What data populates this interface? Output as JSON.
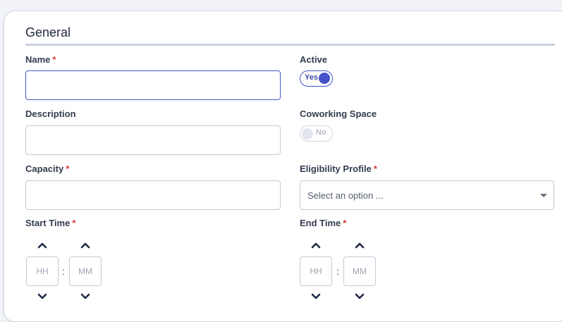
{
  "section": {
    "title": "General"
  },
  "required_marker": "*",
  "fields": {
    "name": {
      "label": "Name",
      "value": ""
    },
    "description": {
      "label": "Description",
      "value": ""
    },
    "capacity": {
      "label": "Capacity",
      "value": ""
    },
    "active": {
      "label": "Active",
      "toggle_text": "Yes",
      "state": "on"
    },
    "coworking": {
      "label": "Coworking Space",
      "toggle_text": "No",
      "state": "off"
    },
    "eligibility": {
      "label": "Eligibility Profile",
      "placeholder": "Select an option ..."
    },
    "start_time": {
      "label": "Start Time",
      "hour_placeholder": "HH",
      "minute_placeholder": "MM",
      "separator": ":"
    },
    "end_time": {
      "label": "End Time",
      "hour_placeholder": "HH",
      "minute_placeholder": "MM",
      "separator": ":"
    }
  },
  "colors": {
    "accent": "#4552c9",
    "required": "#d23c3c",
    "border": "#c4cad6"
  },
  "icons": {
    "time_up": "chevron-up-icon",
    "time_down": "chevron-down-icon",
    "select": "caret-down-icon"
  }
}
